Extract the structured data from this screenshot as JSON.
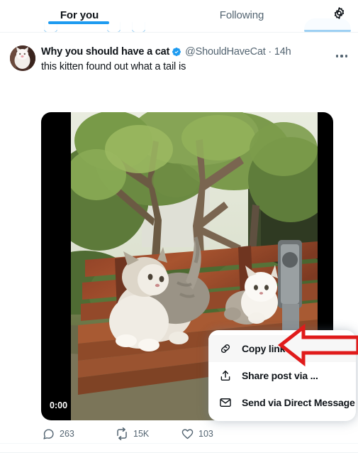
{
  "header": {
    "tabs": [
      {
        "label": "For you",
        "active": true
      },
      {
        "label": "Following",
        "active": false
      }
    ],
    "settings_icon": "gear-icon"
  },
  "post": {
    "display_name": "Why you should have a cat",
    "verified": true,
    "handle": "@ShouldHaveCat",
    "separator": "·",
    "timestamp": "14h",
    "meta": "@ShouldHaveCat · 14h",
    "text": "this kitten found out what a tail is",
    "more_label": "More",
    "avatar_alt": "white cat avatar"
  },
  "video": {
    "time_elapsed": "0:00",
    "alt": "two cats sitting on a wooden park bench in a garden"
  },
  "actions": [
    {
      "name": "reply",
      "icon": "comment-icon",
      "count": "263"
    },
    {
      "name": "repost",
      "icon": "repost-icon",
      "count": "15K"
    },
    {
      "name": "like",
      "icon": "heart-icon",
      "count": "103"
    }
  ],
  "context_menu": {
    "items": [
      {
        "label": "Copy link",
        "icon": "link-icon",
        "hovered": true
      },
      {
        "label": "Share post via ...",
        "icon": "share-upload-icon",
        "hovered": false
      },
      {
        "label": "Send via Direct Message",
        "icon": "envelope-icon",
        "hovered": false
      }
    ]
  },
  "annotation": {
    "type": "arrow",
    "direction": "left",
    "color": "#e01b1b",
    "points_to": "Copy link"
  },
  "colors": {
    "accent": "#1d9bf0",
    "text_primary": "#0f1419",
    "text_secondary": "#536471",
    "background": "#ffffff",
    "annotation_red": "#e01b1b"
  }
}
